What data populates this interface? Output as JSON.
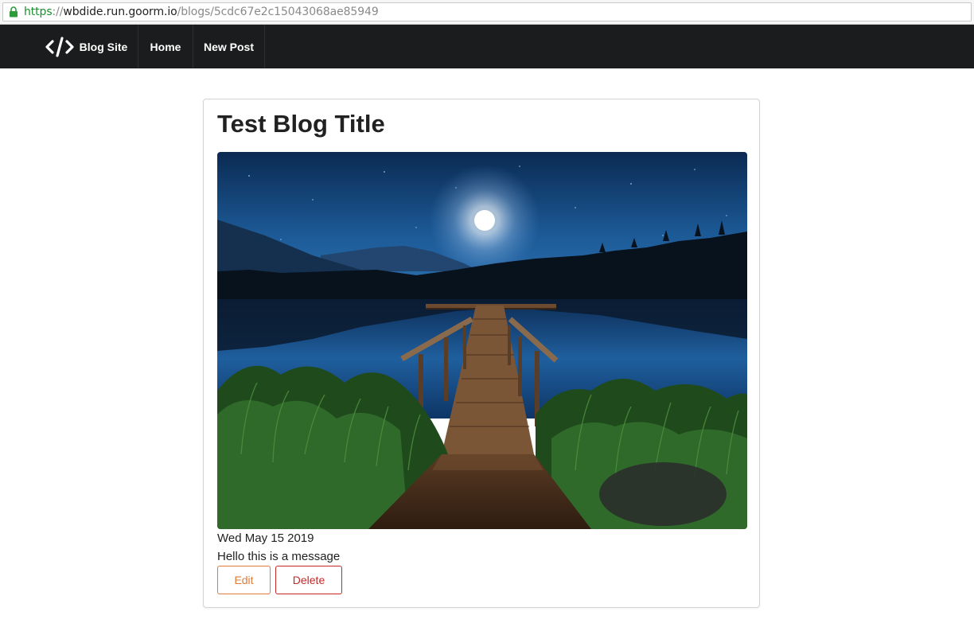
{
  "browser": {
    "url_scheme": "https",
    "url_separator": "://",
    "url_host": "wbdide.run.goorm.io",
    "url_path": "/blogs/5cdc67e2c15043068ae85949"
  },
  "navbar": {
    "brand_label": "Blog Site",
    "brand_icon": "code-icon",
    "items": [
      {
        "label": "Home"
      },
      {
        "label": "New Post"
      }
    ]
  },
  "post": {
    "title": "Test Blog Title",
    "image_subject": "moonlit lake with wooden dock",
    "date": "Wed May 15 2019",
    "body": "Hello this is a message",
    "edit_label": "Edit",
    "delete_label": "Delete"
  },
  "colors": {
    "navbar_bg": "#1b1c1d",
    "edit_accent": "#e07b39",
    "delete_accent": "#c62828",
    "secure_scheme": "#1a8f2d"
  }
}
